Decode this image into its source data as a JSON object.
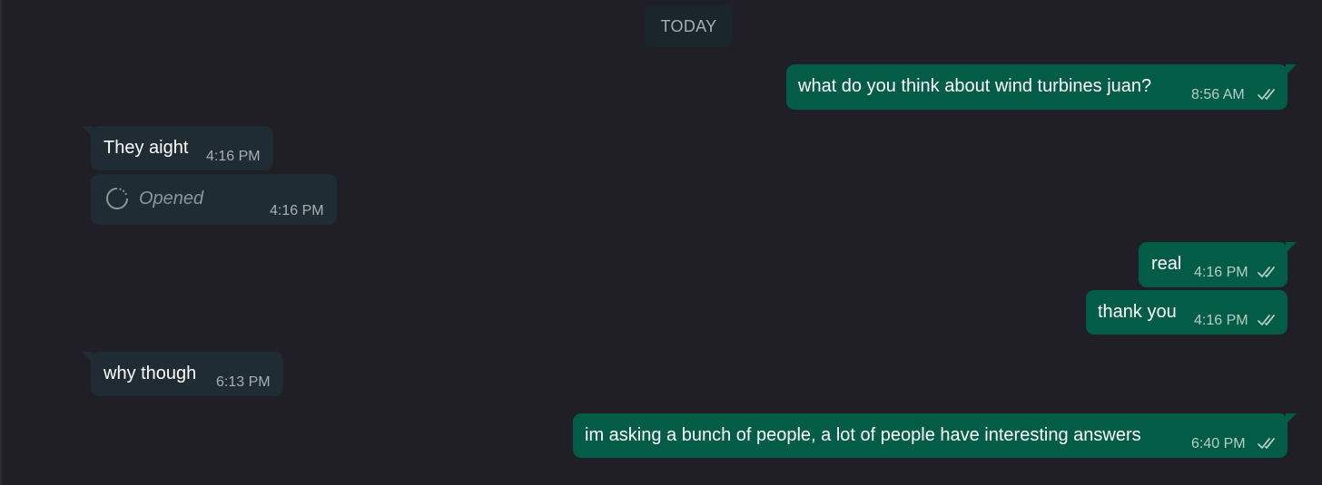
{
  "date_separator": "TODAY",
  "messages": [
    {
      "direction": "outgoing",
      "text": "what do you think about wind turbines juan?",
      "time": "8:56 AM",
      "status": "read"
    },
    {
      "direction": "incoming",
      "text": "They aight",
      "time": "4:16 PM"
    },
    {
      "direction": "incoming",
      "type": "view-once",
      "text": "Opened",
      "time": "4:16 PM"
    },
    {
      "direction": "outgoing",
      "text": "real",
      "time": "4:16 PM",
      "status": "read"
    },
    {
      "direction": "outgoing",
      "text": "thank you",
      "time": "4:16 PM",
      "status": "read"
    },
    {
      "direction": "incoming",
      "text": "why though",
      "time": "6:13 PM"
    },
    {
      "direction": "outgoing",
      "text": "im asking a bunch of people, a lot of people have interesting answers",
      "time": "6:40 PM",
      "status": "read"
    }
  ],
  "colors": {
    "background": "#201f25",
    "incoming_bubble": "#1f2c33",
    "outgoing_bubble": "#035c45",
    "date_chip": "#1b262b"
  },
  "icons": {
    "read_receipt": "double-check-icon",
    "view_once": "view-once-opened-icon"
  }
}
